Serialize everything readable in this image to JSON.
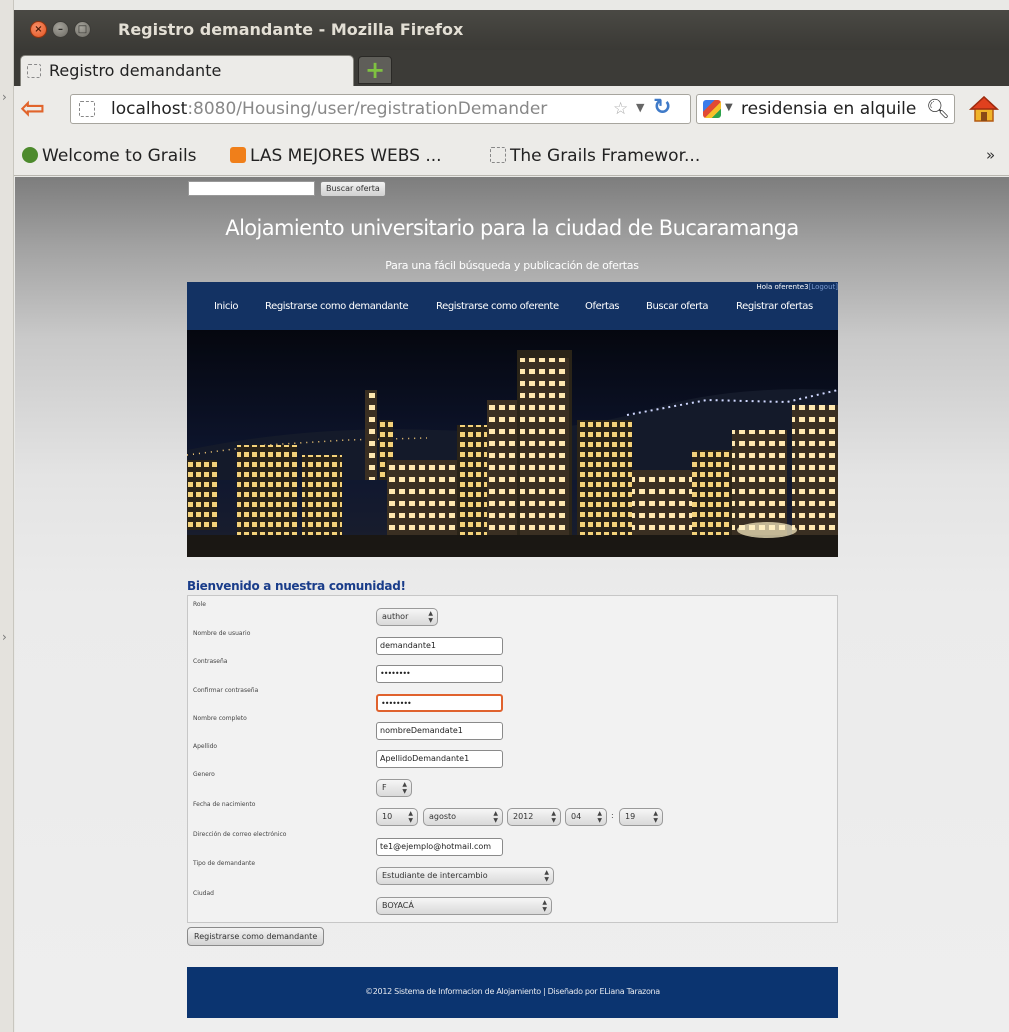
{
  "window": {
    "title": "Registro demandante - Mozilla Firefox"
  },
  "tab": {
    "label": "Registro demandante"
  },
  "urlbar": {
    "host": "localhost",
    "path": ":8080/Housing/user/registrationDemander"
  },
  "searchbar": {
    "query": "residensia en alquile"
  },
  "bookmarks": [
    {
      "label": "Welcome to Grails",
      "icon": "grails-icon"
    },
    {
      "label": "LAS MEJORES WEBS ...",
      "icon": "blogger-icon"
    },
    {
      "label": "The Grails Framewor...",
      "icon": "page-icon"
    }
  ],
  "site": {
    "search_button": "Buscar oferta",
    "title": "Alojamiento universitario para la ciudad de Bucaramanga",
    "subtitle": "Para una fácil búsqueda y publicación de ofertas",
    "greeting": "Hola oferente3",
    "logout": "[Logout]",
    "menu": [
      "Inicio",
      "Registrarse como demandante",
      "Registrarse como oferente",
      "Ofertas",
      "Buscar oferta",
      "Registrar ofertas"
    ]
  },
  "form": {
    "heading": "Bienvenido a nuestra comunidad!",
    "labels": {
      "role": "Role",
      "username": "Nombre de usuario",
      "password": "Contraseña",
      "confirm": "Confirmar contraseña",
      "fullname": "Nombre completo",
      "lastname": "Apellido",
      "gender": "Genero",
      "birthdate": "Fecha de nacimiento",
      "email": "Dirección de correo electrónico",
      "type": "Tipo de demandante",
      "city": "Ciudad"
    },
    "values": {
      "role": "author",
      "username": "demandante1",
      "password": "••••••••",
      "confirm": "••••••••",
      "fullname": "nombreDemandate1",
      "lastname": "ApellidoDemandante1",
      "gender": "F",
      "birth_day": "10",
      "birth_month": "agosto",
      "birth_year": "2012",
      "birth_hour": "04",
      "birth_minute": "19",
      "email": "te1@ejemplo@hotmail.com",
      "type": "Estudiante de intercambio",
      "city": "BOYACÁ"
    },
    "submit": "Registrarse como demandante"
  },
  "footer": {
    "text": "©2012 Sistema de Informacion de Alojamiento | Diseñado por ELiana Tarazona"
  },
  "colors": {
    "menubar": "#133263",
    "footer": "#0b3470",
    "heading": "#1a3d8a",
    "focus": "#e0622e"
  }
}
